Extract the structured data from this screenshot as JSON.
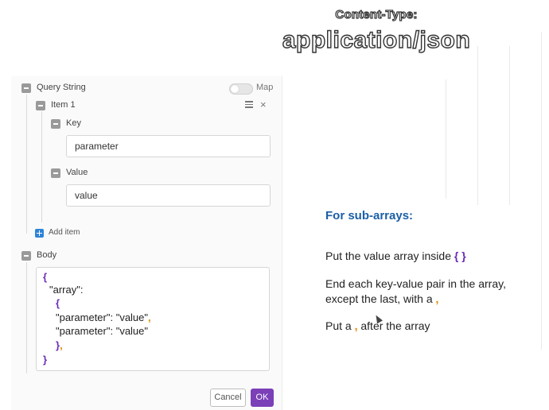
{
  "header": {
    "content_type_label": "Content-Type:",
    "content_type_value": "application/json"
  },
  "panel": {
    "query_string_label": "Query String",
    "map_label": "Map",
    "item_label": "Item 1",
    "menu_icon": "hamburger-icon",
    "close_icon": "close-icon",
    "key_label": "Key",
    "key_value": "parameter",
    "value_label": "Value",
    "value_value": "value",
    "add_item_label": "Add item",
    "body_label": "Body",
    "body_code": {
      "line1": "{",
      "line2": "\"array\":",
      "line3": "{",
      "line4_text": "\"parameter\": \"value\"",
      "line4_comma": ",",
      "line5": "\"parameter\": \"value\"",
      "line6_brace": "}",
      "line6_comma": ",",
      "line7": "}"
    },
    "cancel_label": "Cancel",
    "ok_label": "OK"
  },
  "notes": {
    "heading": "For sub-arrays:",
    "note1_text": "Put the value array inside ",
    "note1_brace": "{ }",
    "note2_line1": "End each key-value pair in the array,",
    "note2_line2_text": "except the last, with a ",
    "note2_line2_comma": ",",
    "note3_before": "Put a ",
    "note3_comma": ",",
    "note3_after": " after the array"
  },
  "colors": {
    "accent_purple": "#7b3fb8",
    "brace_purple": "#6a2bb8",
    "comma_orange": "#e08a00",
    "heading_blue": "#1b5fa6",
    "add_blue": "#2e83d8"
  }
}
